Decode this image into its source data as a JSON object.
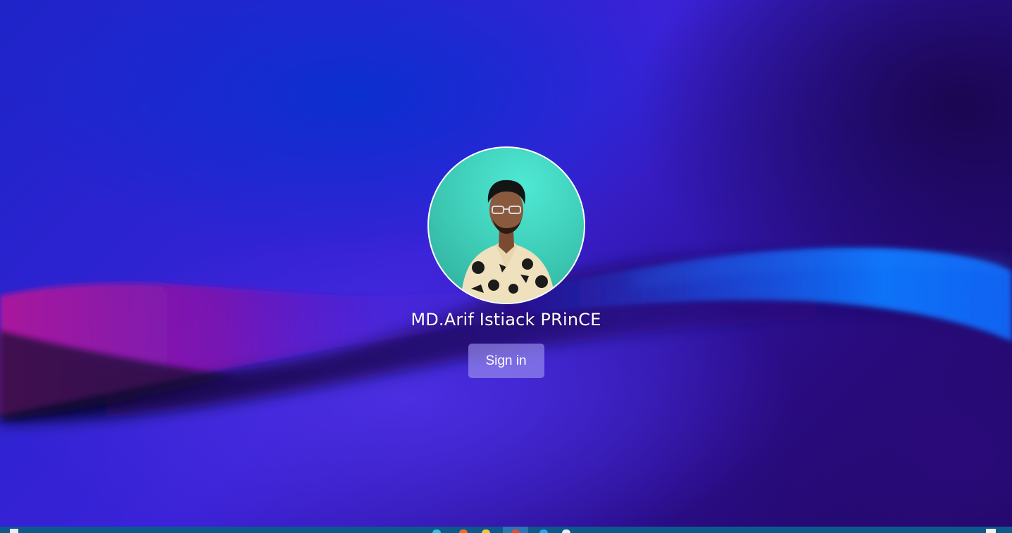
{
  "user": {
    "display_name": "MD.Arif Istiack PRinCE",
    "avatar_icon": "profile-photo"
  },
  "actions": {
    "signin_label": "Sign in"
  },
  "colors": {
    "signin_button_bg": "#9a8ef0",
    "taskbar_bg": "#0d5a8a",
    "avatar_bg": "#3fd6c0"
  },
  "taskbar": {
    "items": [
      "start-icon",
      "search-icon",
      "firefox-icon",
      "file-explorer-icon",
      "chrome-icon",
      "vscode-icon",
      "edge-icon",
      "notification-icon"
    ]
  }
}
